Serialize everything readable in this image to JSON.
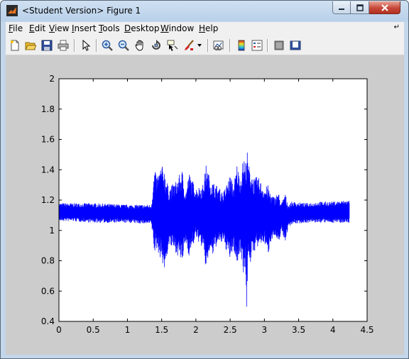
{
  "window": {
    "title": "<Student Version> Figure 1"
  },
  "menu": {
    "items": [
      {
        "key": "file",
        "label": "File",
        "u": "F",
        "rest": "ile"
      },
      {
        "key": "edit",
        "label": "Edit",
        "u": "E",
        "rest": "dit"
      },
      {
        "key": "view",
        "label": "View",
        "u": "V",
        "rest": "iew"
      },
      {
        "key": "insert",
        "label": "Insert",
        "u": "I",
        "rest": "nsert"
      },
      {
        "key": "tools",
        "label": "Tools",
        "u": "T",
        "rest": "ools"
      },
      {
        "key": "desktop",
        "label": "Desktop",
        "u": "D",
        "rest": "esktop"
      },
      {
        "key": "window",
        "label": "Window",
        "u": "W",
        "rest": "indow"
      },
      {
        "key": "help",
        "label": "Help",
        "u": "H",
        "rest": "elp"
      }
    ]
  },
  "toolbar": {
    "buttons": [
      "new-figure-icon",
      "open-file-icon",
      "save-icon",
      "print-icon",
      "pointer-icon",
      "zoom-in-icon",
      "zoom-out-icon",
      "pan-icon",
      "rotate-3d-icon",
      "data-cursor-icon",
      "brush-icon",
      "brush-dropdown-icon",
      "link-plot-icon",
      "colorbar-icon",
      "legend-icon",
      "hide-plot-tools-icon",
      "show-plot-tools-icon"
    ]
  },
  "colors": {
    "signal": "#0000ff",
    "axes_background": "#ffffff",
    "figure_background": "#cccccc"
  },
  "chart_data": {
    "type": "line",
    "title": "",
    "xlabel": "",
    "ylabel": "",
    "xlim": [
      0,
      4.5
    ],
    "ylim": [
      0.4,
      2
    ],
    "xticks": [
      "0",
      "0.5",
      "1",
      "1.5",
      "2",
      "2.5",
      "3",
      "3.5",
      "4",
      "4.5"
    ],
    "yticks": [
      "0.4",
      "0.6",
      "0.8",
      "1",
      "1.2",
      "1.4",
      "1.6",
      "1.8",
      "2"
    ],
    "grid": false,
    "series": [
      {
        "name": "",
        "color": "#0000ff",
        "envelope": {
          "x": [
            0.0,
            0.2,
            0.5,
            1.0,
            1.35,
            1.4,
            1.42,
            1.5,
            1.55,
            1.6,
            1.7,
            1.8,
            1.85,
            1.9,
            2.0,
            2.1,
            2.15,
            2.2,
            2.25,
            2.3,
            2.4,
            2.5,
            2.55,
            2.6,
            2.65,
            2.7,
            2.72,
            2.74,
            2.76,
            2.8,
            2.85,
            2.9,
            3.0,
            3.05,
            3.1,
            3.15,
            3.2,
            3.25,
            3.3,
            3.35,
            3.4,
            3.6,
            3.8,
            4.0,
            4.2,
            4.24
          ],
          "upper": [
            1.18,
            1.18,
            1.18,
            1.17,
            1.17,
            1.42,
            1.35,
            1.43,
            1.4,
            1.28,
            1.32,
            1.4,
            1.25,
            1.38,
            1.28,
            1.3,
            1.44,
            1.35,
            1.32,
            1.3,
            1.25,
            1.37,
            1.3,
            1.44,
            1.35,
            1.5,
            1.42,
            1.6,
            1.45,
            1.4,
            1.34,
            1.36,
            1.28,
            1.3,
            1.24,
            1.22,
            1.26,
            1.18,
            1.25,
            1.17,
            1.19,
            1.18,
            1.19,
            1.19,
            1.2,
            1.2
          ],
          "lower": [
            1.06,
            1.06,
            1.05,
            1.05,
            1.04,
            0.83,
            0.88,
            0.8,
            0.72,
            0.9,
            0.86,
            0.78,
            0.92,
            0.83,
            0.95,
            0.88,
            0.73,
            0.86,
            0.83,
            0.9,
            0.92,
            0.8,
            0.88,
            0.76,
            0.86,
            0.7,
            0.8,
            0.42,
            0.85,
            0.78,
            0.86,
            0.88,
            0.92,
            0.83,
            0.94,
            0.96,
            0.9,
            1.0,
            0.92,
            1.02,
            1.04,
            1.05,
            1.05,
            1.05,
            1.05,
            1.05
          ]
        }
      }
    ]
  }
}
